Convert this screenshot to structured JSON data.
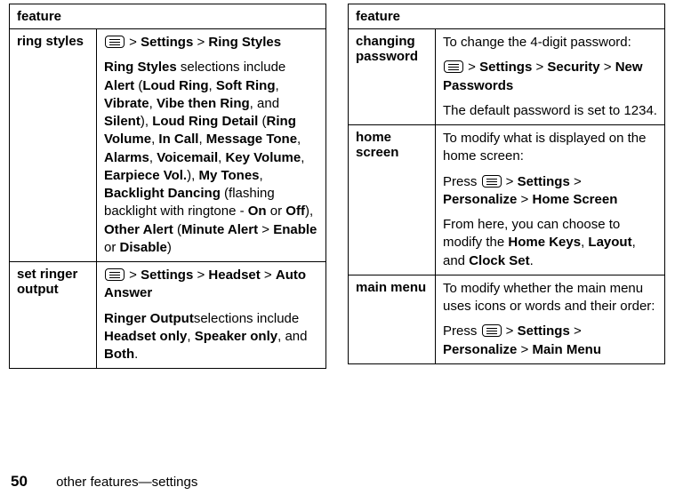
{
  "header": "feature",
  "left": [
    {
      "label": "ring styles",
      "blocks": [
        {
          "type": "path",
          "segments": [
            "Settings",
            "Ring Styles"
          ]
        },
        {
          "type": "rich",
          "parts": [
            {
              "t": "Ring Styles",
              "c": "cnd"
            },
            {
              "t": " selections include "
            },
            {
              "t": "Alert",
              "c": "cnd"
            },
            {
              "t": " ("
            },
            {
              "t": "Loud Ring",
              "c": "cnd"
            },
            {
              "t": ", "
            },
            {
              "t": "Soft Ring",
              "c": "cnd"
            },
            {
              "t": ", "
            },
            {
              "t": "Vibrate",
              "c": "cnd"
            },
            {
              "t": ", "
            },
            {
              "t": "Vibe then Ring",
              "c": "cnd"
            },
            {
              "t": ", and "
            },
            {
              "t": "Silent",
              "c": "cnd"
            },
            {
              "t": "), "
            },
            {
              "t": "Loud Ring Detail",
              "c": "cnd"
            },
            {
              "t": " ("
            },
            {
              "t": "Ring Volume",
              "c": "cnd"
            },
            {
              "t": ", "
            },
            {
              "t": "In Call",
              "c": "cnd"
            },
            {
              "t": ", "
            },
            {
              "t": "Message Tone",
              "c": "cnd"
            },
            {
              "t": ", "
            },
            {
              "t": "Alarms",
              "c": "cnd"
            },
            {
              "t": ", "
            },
            {
              "t": "Voicemail",
              "c": "cnd"
            },
            {
              "t": ", "
            },
            {
              "t": "Key Volume",
              "c": "cnd"
            },
            {
              "t": ", "
            },
            {
              "t": "Earpiece Vol.",
              "c": "cnd"
            },
            {
              "t": "), "
            },
            {
              "t": "My Tones",
              "c": "cnd"
            },
            {
              "t": ", "
            },
            {
              "t": "Backlight Dancing",
              "c": "cnd"
            },
            {
              "t": " (flashing backlight with ringtone - "
            },
            {
              "t": "On",
              "c": "cnd"
            },
            {
              "t": " or "
            },
            {
              "t": "Off",
              "c": "cnd"
            },
            {
              "t": "), "
            },
            {
              "t": "Other Alert",
              "c": "cnd"
            },
            {
              "t": " ("
            },
            {
              "t": "Minute Alert",
              "c": "cnd"
            },
            {
              "t": " > "
            },
            {
              "t": "Enable",
              "c": "cnd"
            },
            {
              "t": " or "
            },
            {
              "t": "Disable",
              "c": "cnd"
            },
            {
              "t": ")"
            }
          ]
        }
      ]
    },
    {
      "label": "set ringer output",
      "blocks": [
        {
          "type": "path",
          "segments": [
            "Settings",
            "Headset",
            "Auto Answer"
          ]
        },
        {
          "type": "rich",
          "parts": [
            {
              "t": "Ringer Output",
              "c": "cnd"
            },
            {
              "t": "selections include "
            },
            {
              "t": "Headset only",
              "c": "cnd"
            },
            {
              "t": ", "
            },
            {
              "t": "Speaker only",
              "c": "cnd"
            },
            {
              "t": ", and "
            },
            {
              "t": "Both",
              "c": "cnd"
            },
            {
              "t": "."
            }
          ]
        }
      ]
    }
  ],
  "right": [
    {
      "label": "changing password",
      "blocks": [
        {
          "type": "plain",
          "text": "To change the 4-digit password:"
        },
        {
          "type": "path",
          "segments": [
            "Settings",
            "Security",
            "New Passwords"
          ]
        },
        {
          "type": "plain",
          "text": "The default password is set to 1234."
        }
      ]
    },
    {
      "label": "home screen",
      "blocks": [
        {
          "type": "plain",
          "text": "To modify what is displayed on the home screen:"
        },
        {
          "type": "path",
          "prefix": "Press",
          "segments": [
            "Settings",
            "Personalize",
            "Home Screen"
          ]
        },
        {
          "type": "rich",
          "parts": [
            {
              "t": "From here, you can choose to modify the "
            },
            {
              "t": "Home Keys",
              "c": "cnd"
            },
            {
              "t": ", "
            },
            {
              "t": "Layout",
              "c": "cnd"
            },
            {
              "t": ", and "
            },
            {
              "t": "Clock Set",
              "c": "cnd"
            },
            {
              "t": "."
            }
          ]
        }
      ]
    },
    {
      "label": "main menu",
      "blocks": [
        {
          "type": "plain",
          "text": "To modify whether the main menu uses icons or words and their order:"
        },
        {
          "type": "path",
          "prefix": "Press",
          "segments": [
            "Settings",
            "Personalize",
            "Main Menu"
          ]
        }
      ]
    }
  ],
  "footer": {
    "page": "50",
    "section": "other features—settings"
  }
}
